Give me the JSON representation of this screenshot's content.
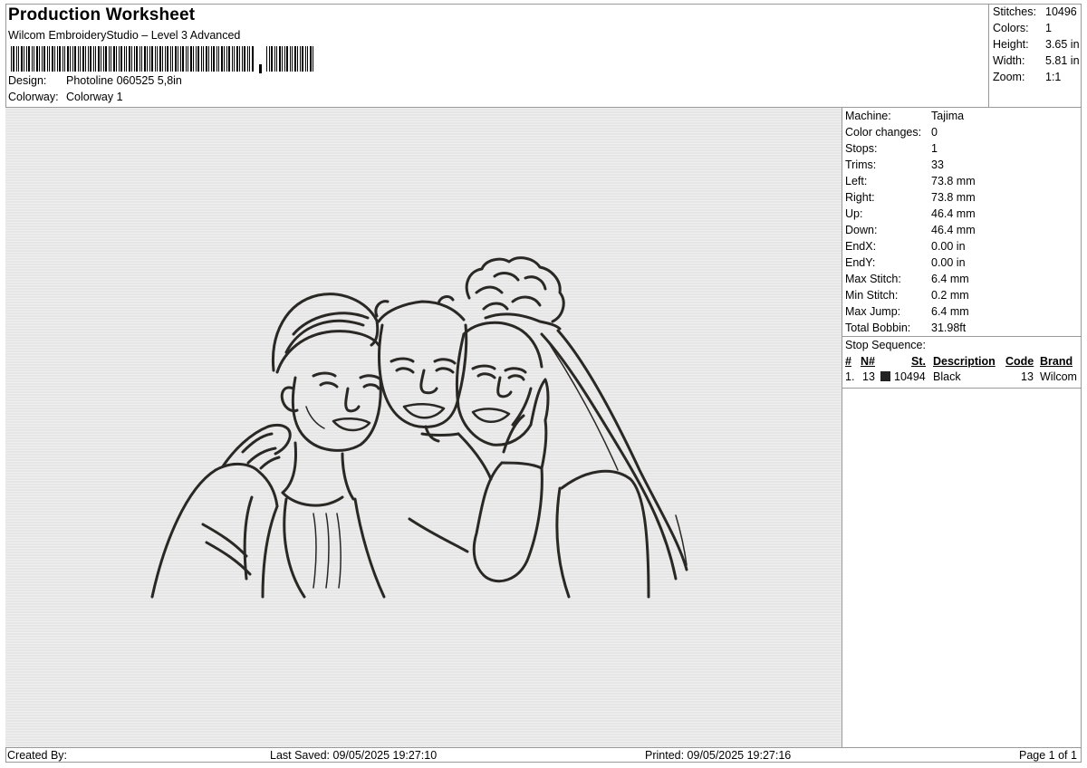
{
  "header": {
    "title": "Production Worksheet",
    "subtitle": "Wilcom EmbroideryStudio – Level 3 Advanced",
    "design_label": "Design:",
    "design_value": "Photoline 060525 5,8in",
    "colorway_label": "Colorway:",
    "colorway_value": "Colorway 1"
  },
  "summary": [
    {
      "label": "Stitches:",
      "value": "10496"
    },
    {
      "label": "Colors:",
      "value": "1"
    },
    {
      "label": "Height:",
      "value": "3.65 in"
    },
    {
      "label": "Width:",
      "value": "5.81 in"
    },
    {
      "label": "Zoom:",
      "value": "1:1"
    }
  ],
  "details": [
    {
      "label": "Machine:",
      "value": "Tajima"
    },
    {
      "label": "Color changes:",
      "value": "0"
    },
    {
      "label": "Stops:",
      "value": "1"
    },
    {
      "label": "Trims:",
      "value": "33"
    },
    {
      "label": "Left:",
      "value": "73.8 mm"
    },
    {
      "label": "Right:",
      "value": "73.8 mm"
    },
    {
      "label": "Up:",
      "value": "46.4 mm"
    },
    {
      "label": "Down:",
      "value": "46.4 mm"
    },
    {
      "label": "EndX:",
      "value": "0.00 in"
    },
    {
      "label": "EndY:",
      "value": "0.00 in"
    },
    {
      "label": "Max Stitch:",
      "value": "6.4 mm"
    },
    {
      "label": "Min Stitch:",
      "value": "0.2 mm"
    },
    {
      "label": "Max Jump:",
      "value": "6.4 mm"
    },
    {
      "label": "Total Bobbin:",
      "value": "31.98ft"
    }
  ],
  "stop_sequence": {
    "label": "Stop Sequence:",
    "headers": {
      "num": "#",
      "n": "N#",
      "st": "St.",
      "description": "Description",
      "code": "Code",
      "brand": "Brand"
    },
    "rows": [
      {
        "num": "1.",
        "n": "13",
        "swatch_color": "#222222",
        "st": "10494",
        "description": "Black",
        "code": "13",
        "brand": "Wilcom"
      }
    ]
  },
  "footer": {
    "created_by": "Created By:",
    "last_saved": "Last Saved: 09/05/2025 19:27:10",
    "printed": "Printed: 09/05/2025 19:27:16",
    "page": "Page 1 of 1"
  },
  "colors": {
    "thread": "#2a2824",
    "preview_bg": "#e6e6e6"
  }
}
